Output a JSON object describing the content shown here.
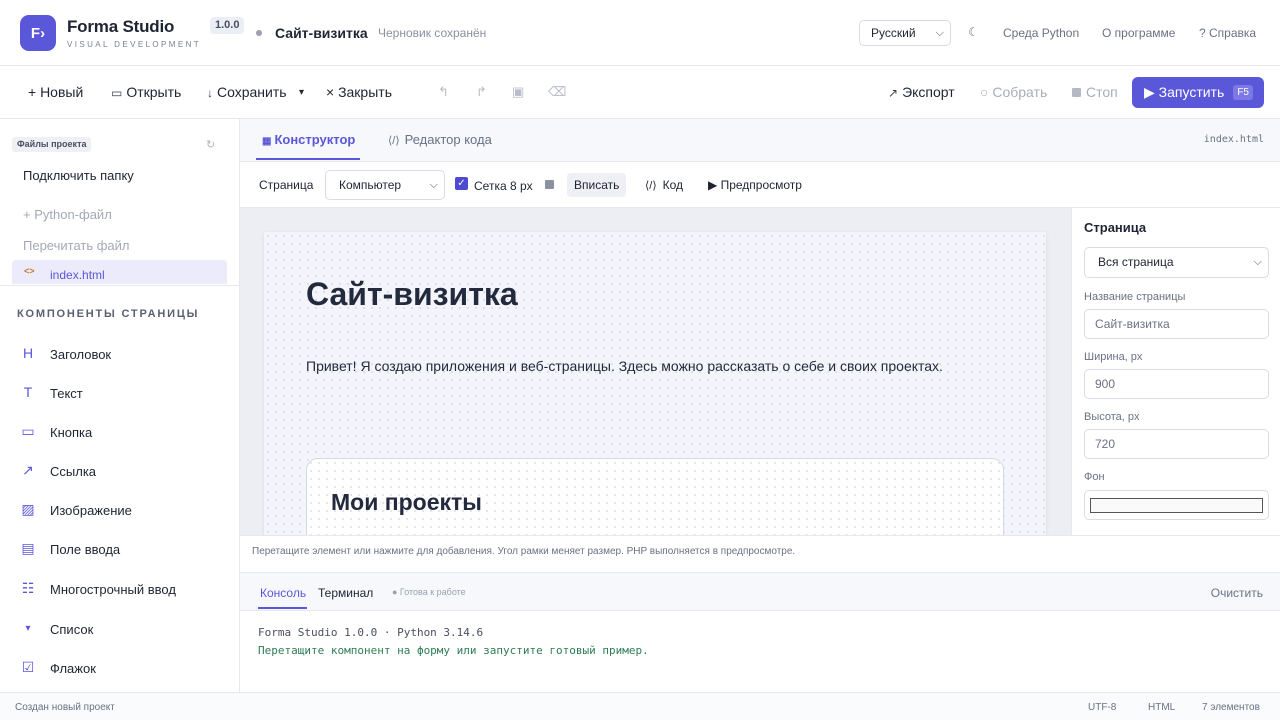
{
  "header": {
    "logo_text": "F›",
    "brand_name": "Forma Studio",
    "brand_sub": "VISUAL DEVELOPMENT",
    "version": "1.0.0",
    "doc_title": "Сайт-визитка",
    "draft_status": "Черновик сохранён",
    "language": "Русский",
    "theme_icon": "moon-icon",
    "links": [
      "Среда Python",
      "О программе",
      "? Справка"
    ]
  },
  "toolbar": {
    "new": "+ Новый",
    "open": "Открыть",
    "save": "Сохранить",
    "save_menu": "▾",
    "close": "× Закрыть",
    "export": "Экспорт",
    "build": "○ Собрать",
    "stop": "Стоп",
    "run": "▶ Запустить",
    "run_key": "F5"
  },
  "sidebar": {
    "files_tag": "Файлы проекта",
    "connect_folder": "Подключить папку",
    "python_file": "+ Python-файл",
    "reread_file": "Перечитать файл",
    "file_icon": "<>",
    "file_name": "index.html",
    "components_heading": "КОМПОНЕНТЫ СТРАНИЦЫ",
    "components": [
      {
        "icon": "H",
        "label": "Заголовок"
      },
      {
        "icon": "T",
        "label": "Текст"
      },
      {
        "icon": "▭",
        "label": "Кнопка"
      },
      {
        "icon": "↗",
        "label": "Ссылка"
      },
      {
        "icon": "▨",
        "label": "Изображение"
      },
      {
        "icon": "▤",
        "label": "Поле ввода"
      },
      {
        "icon": "☷",
        "label": "Многострочный ввод"
      },
      {
        "icon": "▾",
        "label": "Список"
      },
      {
        "icon": "☑",
        "label": "Флажок"
      }
    ]
  },
  "editor": {
    "tab_constructor": "Конструктор",
    "tab_code": "Редактор кода",
    "filename": "index.html",
    "page_label": "Страница",
    "device": "Компьютер",
    "grid_label": "Сетка 8 px",
    "grid_checked": true,
    "fit": "Вписать",
    "code": "Код",
    "preview": "▶ Предпросмотр"
  },
  "canvas": {
    "heading": "Сайт-визитка",
    "paragraph": "Привет! Я создаю приложения и веб-страницы. Здесь можно рассказать о себе и своих проектах.",
    "projects_heading": "Мои проекты"
  },
  "properties": {
    "title": "Страница",
    "scope": "Вся страница",
    "page_name_label": "Название страницы",
    "page_name_value": "Сайт-визитка",
    "width_label": "Ширина, px",
    "width_value": "900",
    "height_label": "Высота, px",
    "height_value": "720",
    "bg_label": "Фон",
    "bg_color": "#fafafa"
  },
  "hint": "Перетащите элемент или нажмите для добавления. Угол рамки меняет размер. PHP выполняется в предпросмотре.",
  "console": {
    "tab_console": "Консоль",
    "tab_terminal": "Терминал",
    "status": "● Готова к работе",
    "clear": "Очистить",
    "lines": [
      "Forma Studio 1.0.0 · Python 3.14.6",
      "Перетащите компонент на форму или запустите готовый пример."
    ]
  },
  "statusbar": {
    "message": "Создан новый проект",
    "encoding": "UTF-8",
    "mode": "HTML",
    "elements": "7 элементов"
  },
  "colors": {
    "accent": "#5b57d9",
    "console_green": "#2e7d52"
  }
}
